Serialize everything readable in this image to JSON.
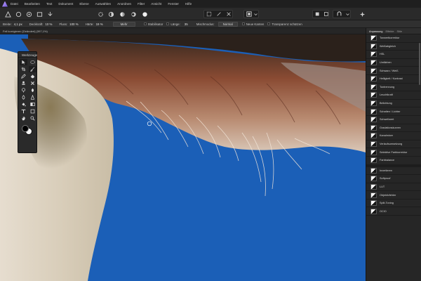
{
  "menu": [
    "Datei",
    "Bearbeiten",
    "Text",
    "Dokument",
    "Ebene",
    "Auswählen",
    "Anordnen",
    "Filter",
    "Ansicht",
    "Fenster",
    "Hilfe"
  ],
  "context_bar": {
    "breite_label": "Breite:",
    "breite_value": "4,1 px",
    "deckkraft_label": "Deckkraft:",
    "deckkraft_value": "10 %",
    "fluss_label": "Fluss:",
    "fluss_value": "100 %",
    "haerte_label": "Härte:",
    "haerte_value": "19 %",
    "mehr_label": "Mehr",
    "stabilisator_label": "Stabilisator",
    "laenge_label": "Länge:",
    "laenge_value": "35",
    "mischmodus_label": "Mischmodus:",
    "mischmodus_value": "Normal",
    "neue_kanten_label": "Neue Kanten",
    "transparenz_label": "Transparenz schützen"
  },
  "document_tab": "Fell korrigieren [Geändert] (397,1%)",
  "tools_panel": {
    "title": "Werkzeuge",
    "tools": [
      "move-icon",
      "select-icon",
      "crop-icon",
      "brush-icon",
      "pencil-icon",
      "eraser-icon",
      "stamp-icon",
      "heal-icon",
      "dodge-icon",
      "burn-icon",
      "blur-icon",
      "sharpen-icon",
      "fill-icon",
      "gradient-icon",
      "text-icon",
      "shape-icon",
      "hand-icon",
      "zoom-icon"
    ],
    "foreground_color": "#000000",
    "background_color": "#f5f5f5"
  },
  "right_panel": {
    "tabs": [
      "Anpassung",
      "Effekte",
      "Stile"
    ],
    "active_tab": 0,
    "adjustments_group1": [
      "Tonwertkorrektur",
      "Weißabgleich",
      "HSL",
      "Umfärben",
      "Schwarz / Weiß",
      "Helligkeit / Kontrast",
      "Tontrennung",
      "Leuchtkraft",
      "Belichtung",
      "Schatten / Lichter",
      "Schwellwert",
      "Gradationskurven",
      "Kanalmixer",
      "Verlaufsumsetzung",
      "Selektive Farbkorrektur",
      "Farbbalance"
    ],
    "adjustments_group2": [
      "Invertieren",
      "Softproof",
      "LUT",
      "Objektivfehler",
      "Split-Toning",
      "OCIO"
    ]
  },
  "colors": {
    "canvas_blue": "#1b5fb7",
    "panel_bg": "#262626",
    "menubar_bg": "#1f1f1f"
  }
}
